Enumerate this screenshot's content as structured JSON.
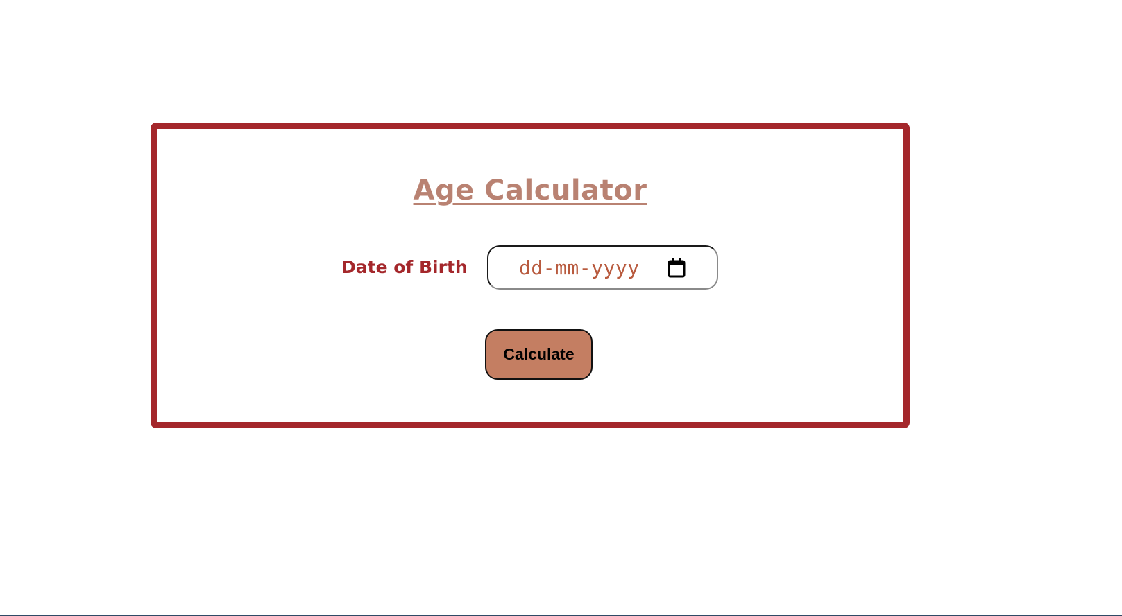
{
  "card": {
    "title": "Age Calculator",
    "dob_label": "Date of Birth",
    "dob_input": {
      "placeholder": "dd-mm-yyyy",
      "value": "",
      "icon": "calendar-icon"
    },
    "calculate_label": "Calculate"
  },
  "colors": {
    "border": "#a4272b",
    "title": "#b98272",
    "label": "#a4272b",
    "placeholder": "#b85a3e",
    "button_bg": "#c47e62"
  }
}
